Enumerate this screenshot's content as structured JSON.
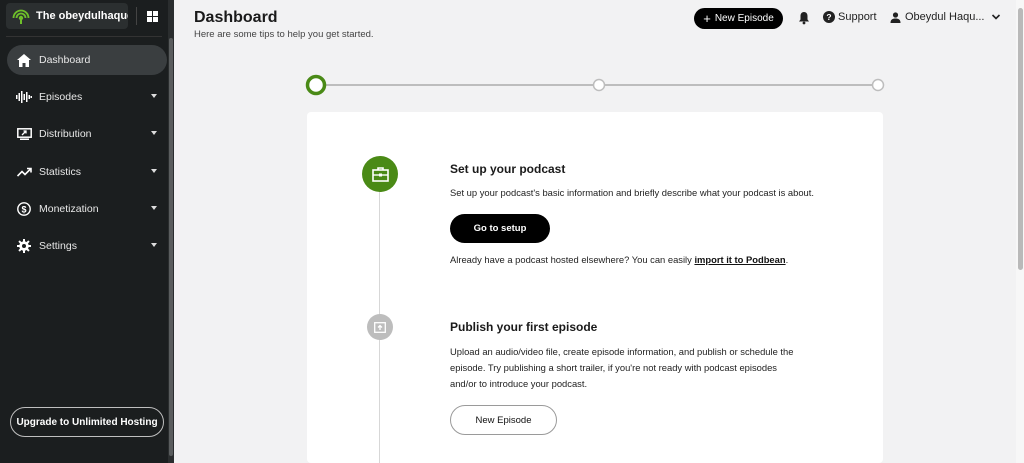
{
  "sidebar": {
    "podcast_title": "The obeydulhaquem'...",
    "items": [
      {
        "label": "Dashboard",
        "icon": "home-icon"
      },
      {
        "label": "Episodes",
        "icon": "waveform-icon"
      },
      {
        "label": "Distribution",
        "icon": "share-screen-icon"
      },
      {
        "label": "Statistics",
        "icon": "trend-up-icon"
      },
      {
        "label": "Monetization",
        "icon": "dollar-icon"
      },
      {
        "label": "Settings",
        "icon": "gear-icon"
      }
    ],
    "upgrade_label": "Upgrade to Unlimited Hosting"
  },
  "header": {
    "title": "Dashboard",
    "subtitle": "Here are some tips to help you get started.",
    "new_episode_label": "New Episode",
    "support_label": "Support",
    "user_label": "Obeydul Haqu..."
  },
  "steps": [
    {
      "title": "Set up your podcast",
      "text": "Set up your podcast's basic information and briefly describe what your podcast is about.",
      "button_label": "Go to setup",
      "import_prefix": "Already have a podcast hosted elsewhere? You can easily ",
      "import_link": "import it to Podbean",
      "import_suffix": "."
    },
    {
      "title": "Publish your first episode",
      "text": "Upload an audio/video file, create episode information, and publish or schedule the episode. Try publishing a short trailer, if you're not ready with podcast episodes and/or to introduce your podcast.",
      "button_label": "New Episode"
    }
  ],
  "colors": {
    "accent_green": "#4a8a16",
    "sidebar_bg": "#1b1e1f",
    "inactive_step": "#bdbdbd"
  }
}
